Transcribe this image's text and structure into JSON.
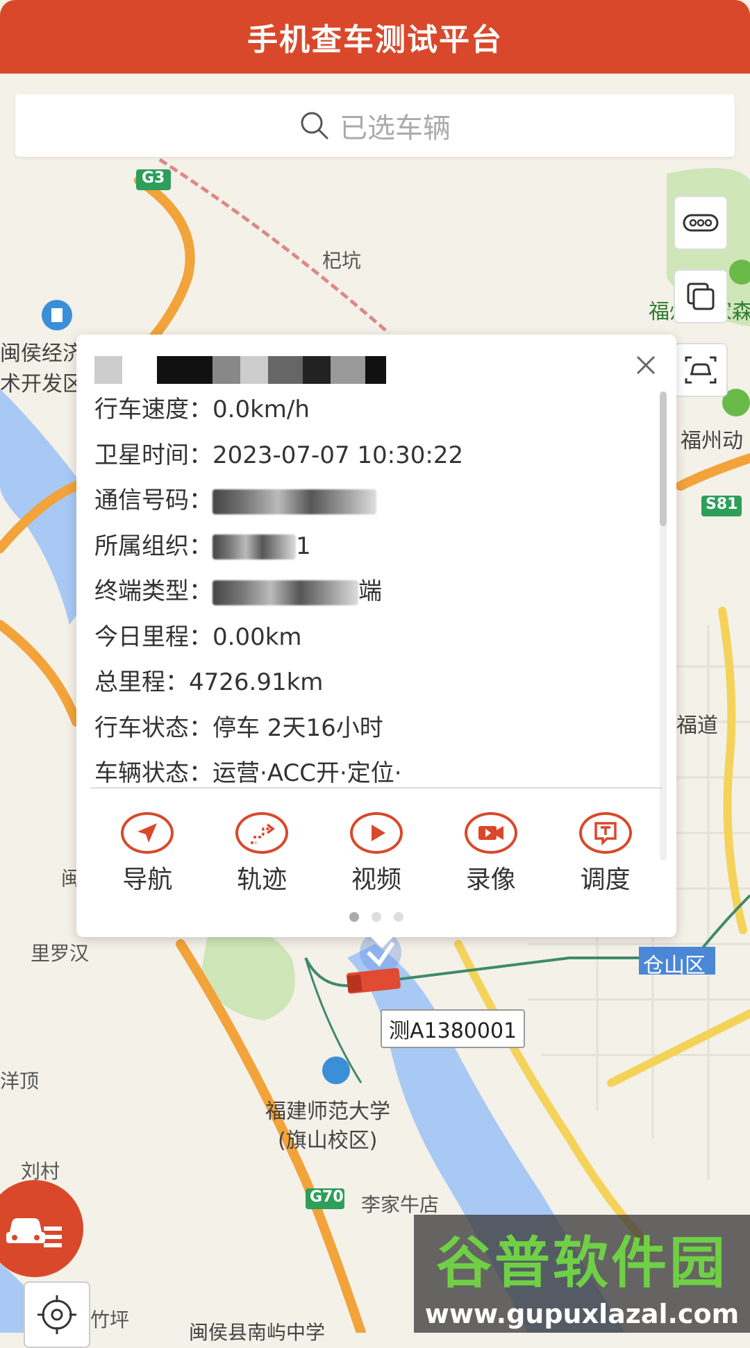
{
  "header": {
    "title": "手机查车测试平台"
  },
  "search": {
    "placeholder": "已选车辆"
  },
  "popup": {
    "rows": [
      {
        "label": "行车速度：",
        "value": "0.0km/h"
      },
      {
        "label": "卫星时间：",
        "value": "2023-07-07 10:30:22"
      },
      {
        "label": "通信号码：",
        "value": ""
      },
      {
        "label": "所属组织：",
        "value": "1"
      },
      {
        "label": "终端类型：",
        "value": "端"
      },
      {
        "label": "今日里程：",
        "value": "0.00km"
      },
      {
        "label": "总里程：",
        "value": "4726.91km"
      },
      {
        "label": "行车状态：",
        "value": "停车 2天16小时"
      },
      {
        "label": "车辆状态：",
        "value": "运营·ACC开·定位·"
      }
    ],
    "actions": [
      {
        "label": "导航",
        "icon": "navigate-icon"
      },
      {
        "label": "轨迹",
        "icon": "track-icon"
      },
      {
        "label": "视频",
        "icon": "video-play-icon"
      },
      {
        "label": "录像",
        "icon": "camera-icon"
      },
      {
        "label": "调度",
        "icon": "dispatch-icon"
      }
    ],
    "page_count": 3,
    "active_page": 1
  },
  "vehicle": {
    "plate": "测A1380001"
  },
  "map_labels": {
    "l1": "杞坑",
    "l2": "闽侯经济",
    "l3": "术开发区",
    "l4": "福州国家森",
    "l5": "福州动",
    "l6": "S81",
    "l7": "G3",
    "l8": "仓山区",
    "l9": "里罗汉",
    "l10": "福建师范大学",
    "l11": "(旗山校区)",
    "l12": "李家牛店",
    "l13": "G70",
    "l14": "刘村",
    "l15": "洋顶",
    "l16": "闽侯县南屿中学",
    "l17": "竹坪",
    "l18": "福道",
    "l19": "闽"
  },
  "watermark": {
    "brand": "谷普软件园",
    "url": "www.gupuxlazal.com"
  },
  "colors": {
    "accent": "#d9482a",
    "water": "#a9c9f5",
    "highway": "#f2a33a",
    "road": "#f5d35a"
  }
}
